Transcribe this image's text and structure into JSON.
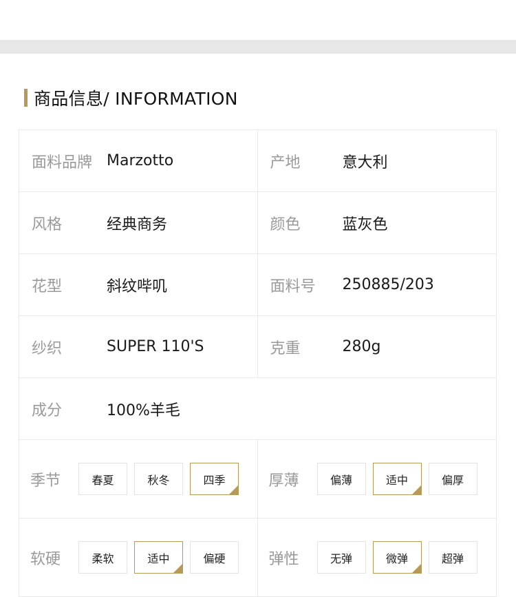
{
  "heading": "商品信息/ INFORMATION",
  "rows": [
    {
      "l_label": "面料品牌",
      "l_value": "Marzotto",
      "r_label": "产地",
      "r_value": "意大利"
    },
    {
      "l_label": "风格",
      "l_value": "经典商务",
      "r_label": "颜色",
      "r_value": "蓝灰色"
    },
    {
      "l_label": "花型",
      "l_value": "斜纹哔叽",
      "r_label": "面料号",
      "r_value": "250885/203"
    },
    {
      "l_label": "纱织",
      "l_value": "SUPER 110'S",
      "r_label": "克重",
      "r_value": "280g"
    }
  ],
  "composition": {
    "label": "成分",
    "value": "100%羊毛"
  },
  "season": {
    "label": "季节",
    "options": [
      "春夏",
      "秋冬",
      "四季"
    ],
    "selected": "四季"
  },
  "thickness": {
    "label": "厚薄",
    "options": [
      "偏薄",
      "适中",
      "偏厚"
    ],
    "selected": "适中"
  },
  "hardness": {
    "label": "软硬",
    "options": [
      "柔软",
      "适中",
      "偏硬"
    ],
    "selected": "适中"
  },
  "elasticity": {
    "label": "弹性",
    "options": [
      "无弹",
      "微弹",
      "超弹"
    ],
    "selected": "微弹"
  },
  "colors": {
    "accent": "#b79a57",
    "label_gray": "#9a9a9a",
    "border": "#e9e9e9",
    "band": "#e7e7e7"
  }
}
